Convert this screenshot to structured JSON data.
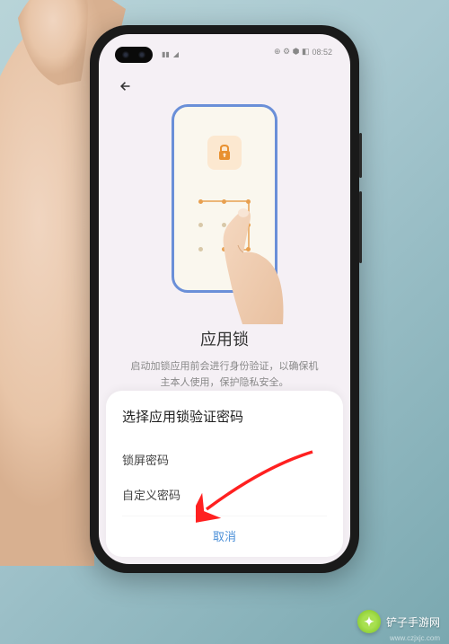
{
  "status_bar": {
    "time": "08:52",
    "signal": "●●●",
    "wifi": "▲"
  },
  "screen": {
    "title": "应用锁",
    "subtitle_line1": "启动加锁应用前会进行身份验证，以确保机",
    "subtitle_line2": "主本人使用，保护隐私安全。"
  },
  "sheet": {
    "title": "选择应用锁验证密码",
    "option1": "锁屏密码",
    "option2": "自定义密码",
    "cancel": "取消"
  },
  "watermark": {
    "brand": "铲子手游网",
    "url": "www.czjxjc.com"
  }
}
